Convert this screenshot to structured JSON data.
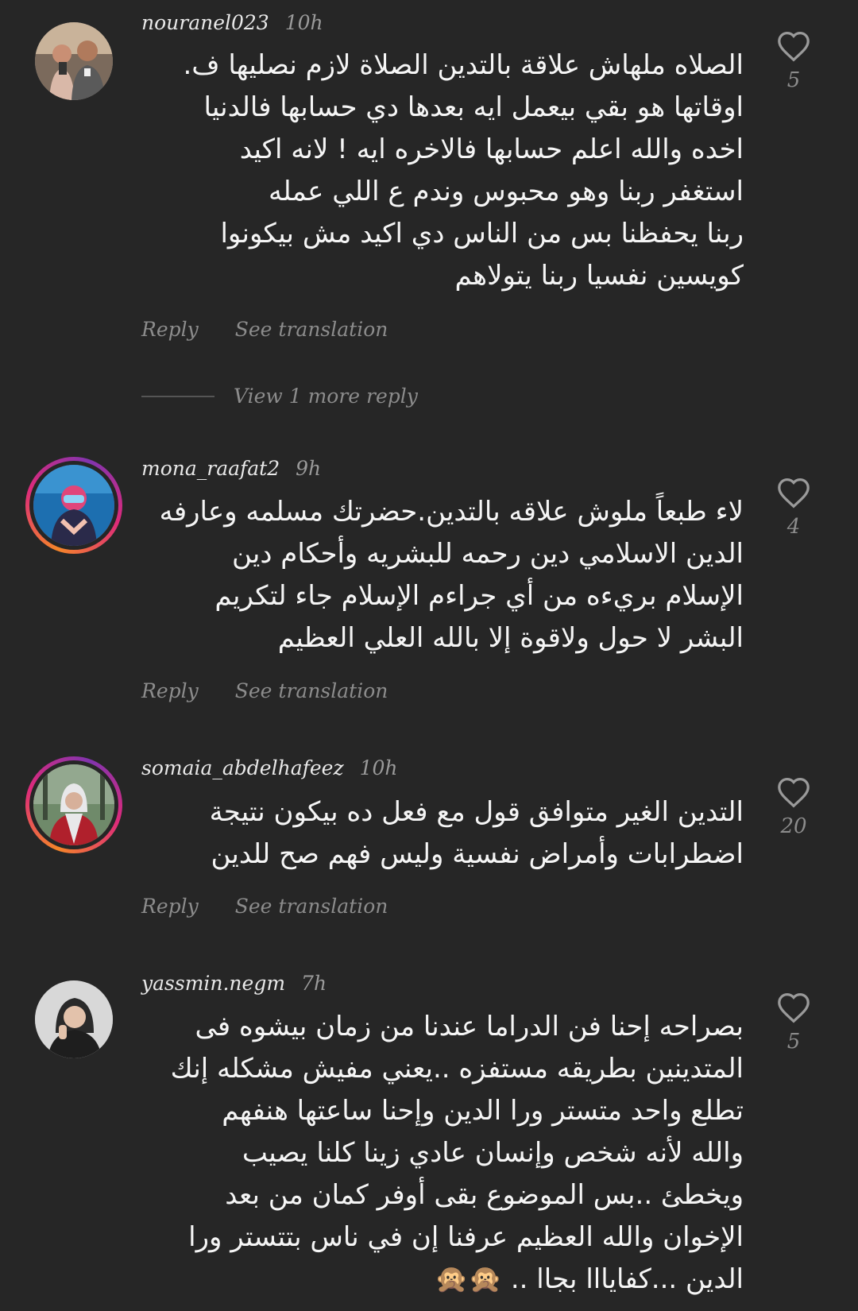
{
  "common": {
    "reply_label": "Reply",
    "translate_label": "See translation"
  },
  "comments": [
    {
      "username": "nouranel023",
      "time": "10h",
      "lines": [
        "الصلاه ملهاش علاقة بالتدين الصلاة لازم نصليها ف.",
        "اوقاتها هو بقي بيعمل ايه بعدها دي حسابها فالدنيا",
        "اخده والله اعلم حسابها فالاخره ايه ! لانه اكيد",
        "استغفر ربنا وهو محبوس وندم ع اللي عمله",
        "ربنا يحفظنا بس من الناس دي اكيد مش بيكونوا",
        "كويسين نفسيا ربنا يتولاهم"
      ],
      "likes": "5",
      "view_more": "View 1 more reply"
    },
    {
      "username": "mona_raafat2",
      "time": "9h",
      "lines": [
        "لاء طبعاً ملوش علاقه بالتدين.حضرتك مسلمه وعارفه",
        "الدين الاسلامي دين رحمه للبشريه وأحكام دين",
        "الإسلام بريءه من أي جراءم الإسلام جاء لتكريم",
        "البشر لا حول ولاقوة إلا بالله العلي العظيم"
      ],
      "likes": "4"
    },
    {
      "username": "somaia_abdelhafeez",
      "time": "10h",
      "lines": [
        "التدين الغير متوافق قول مع فعل ده بيكون نتيجة",
        "اضطرابات وأمراض نفسية وليس فهم صح للدين"
      ],
      "likes": "20"
    },
    {
      "username": "yassmin.negm",
      "time": "7h",
      "lines": [
        "بصراحه إحنا فن الدراما عندنا من زمان بيشوه فى",
        "المتدينين بطريقه مستفزه ..يعني مفيش مشكله إنك",
        "تطلع واحد متستر ورا الدين وإحنا ساعتها هنفهم",
        "والله لأنه شخص وإنسان عادي زينا كلنا يصيب",
        "ويخطئ ..بس الموضوع بقى أوفر كمان من بعد",
        "الإخوان  والله العظيم عرفنا إن في ناس بتتستر ورا",
        "الدين ...كفايااا بجاا .. 🙊🙊"
      ],
      "likes": "5"
    }
  ]
}
